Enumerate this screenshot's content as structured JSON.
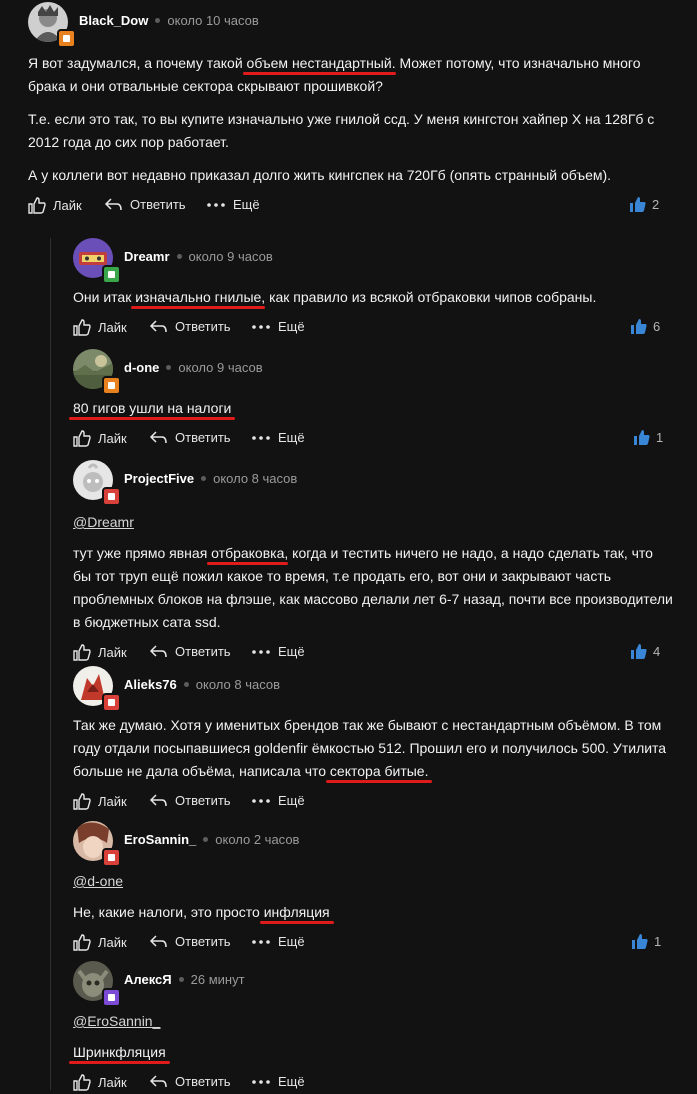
{
  "comments": [
    {
      "author": "Black_Dow",
      "time": "около 10 часов",
      "mention": "",
      "badge_color": "#e8821e",
      "paragraphs": [
        [
          {
            "t": "Я вот задумался, а почему "
          },
          {
            "t": "такой "
          },
          {
            "t": "объем нестандартный",
            "u": true
          },
          {
            "t": ". Может потому, что изначально много брака и они отвальные сектора скрывают прошивкой?"
          }
        ],
        [
          {
            "t": "Т.е. если это так, то вы купите изначально уже гнилой ссд. У меня кингстон хайпер Х на 128Гб с 2012 года до сих пор работает."
          }
        ],
        [
          {
            "t": "А у коллеги вот недавно приказал долго жить кингспек на 720Гб (опять странный объем)."
          }
        ]
      ],
      "likes": "2"
    },
    {
      "author": "Dreamr",
      "time": "около 9 часов",
      "mention": "",
      "badge_color": "#3aa64a",
      "paragraphs": [
        [
          {
            "t": "Они итак "
          },
          {
            "t": "изначально гнилые",
            "u": true
          },
          {
            "t": ", как правило из всякой отбраковки чипов собраны."
          }
        ]
      ],
      "likes": "6"
    },
    {
      "author": "d-one",
      "time": "около 9 часов",
      "mention": "",
      "badge_color": "#e8821e",
      "paragraphs": [
        [
          {
            "t": "80 гигов ушли на налоги",
            "u": true
          }
        ]
      ],
      "likes": "1"
    },
    {
      "author": "ProjectFive",
      "time": "около 8 часов",
      "mention": "@Dreamr",
      "badge_color": "#d8403a",
      "paragraphs": [
        [
          {
            "t": "тут уже прямо явная "
          },
          {
            "t": "отбраковка",
            "u": true
          },
          {
            "t": ", когда и  тестить ничего не надо, а надо сделать так, что бы тот труп ещё пожил какое то время, т.е продать его, вот они и закрывают часть проблемных блоков на флэше, как массово делали лет 6-7 назад, почти все производители в бюджетных сата ssd."
          }
        ]
      ],
      "likes": "4"
    },
    {
      "author": "Alieks76",
      "time": "около 8 часов",
      "mention": "",
      "badge_color": "#d8403a",
      "paragraphs": [
        [
          {
            "t": "Так же думаю. Хотя у именитых брендов так же бывают с нестандартным объёмом. В том году отдали посыпавшиеся goldenfir ёмкостью 512. Прошил его и получилось 500. Утилита больше не дала объёма, написала что "
          },
          {
            "t": "сектора битые.",
            "u": true
          }
        ]
      ],
      "likes": ""
    },
    {
      "author": "EroSannin_",
      "time": "около 2 часов",
      "mention": "@d-one",
      "badge_color": "#d8403a",
      "paragraphs": [
        [
          {
            "t": "Не, какие налоги, это просто "
          },
          {
            "t": "инфляция",
            "u": true
          }
        ]
      ],
      "likes": "1"
    },
    {
      "author": "АлексЯ",
      "time": "26 минут",
      "mention": "@EroSannin_",
      "badge_color": "#7b4bd6",
      "paragraphs": [
        [
          {
            "t": "Шринкфляция",
            "u": true
          }
        ]
      ],
      "likes": ""
    }
  ],
  "actions": {
    "like": "Лайк",
    "reply": "Ответить",
    "more": "Ещё"
  },
  "colors": {
    "background": "#121212",
    "underline": "#e01b1b",
    "like_icon": "#3a86d6",
    "thread_line": "#2f2f2f"
  },
  "icons": {
    "like": "thumbs-up-icon",
    "reply": "reply-arrow-icon",
    "more": "dots-icon"
  }
}
